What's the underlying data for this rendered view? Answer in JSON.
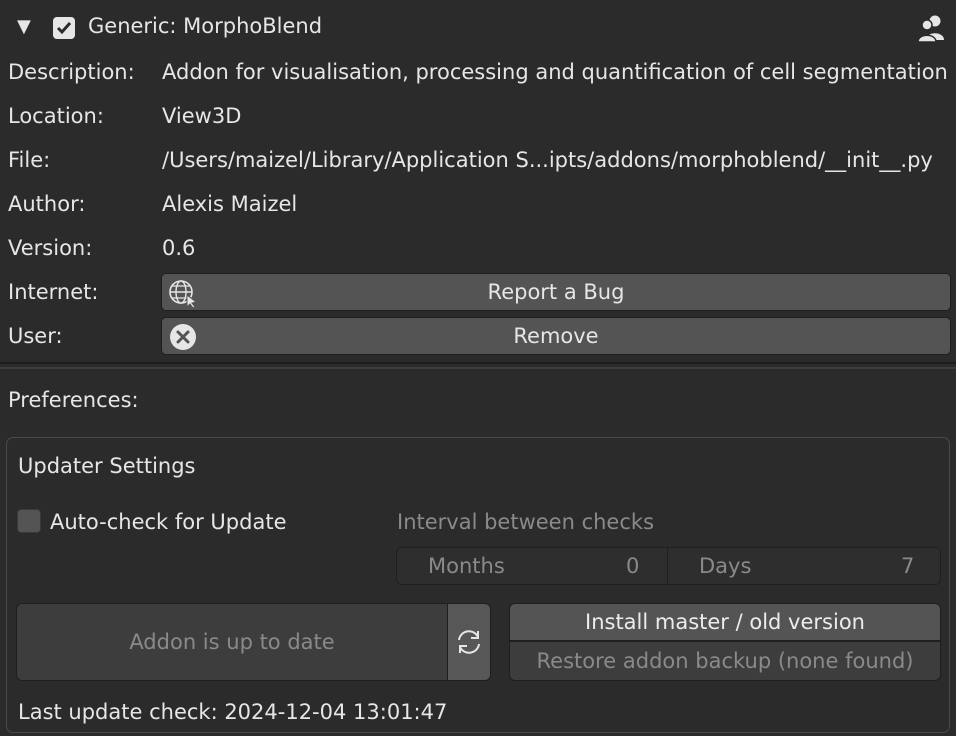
{
  "addon": {
    "title": "Generic: MorphoBlend",
    "enabled": true
  },
  "info": {
    "description_label": "Description:",
    "description_value": "Addon for visualisation, processing and quantification of cell segmentation",
    "location_label": "Location:",
    "location_value": "View3D",
    "file_label": "File:",
    "file_value": "/Users/maizel/Library/Application S...ipts/addons/morphoblend/__init__.py",
    "author_label": "Author:",
    "author_value": "Alexis Maizel",
    "version_label": "Version:",
    "version_value": "0.6",
    "internet_label": "Internet:",
    "report_bug_label": "Report a Bug",
    "user_label": "User:",
    "remove_label": "Remove"
  },
  "preferences": {
    "heading": "Preferences:",
    "updater": {
      "title": "Updater Settings",
      "autocheck_label": "Auto-check for Update",
      "autocheck_checked": false,
      "interval_label": "Interval between checks",
      "months_label": "Months",
      "months_value": "0",
      "days_label": "Days",
      "days_value": "7",
      "status_label": "Addon is up to date",
      "install_label": "Install master / old version",
      "restore_label": "Restore addon backup (none found)",
      "last_check": "Last update check: 2024-12-04 13:01:47"
    }
  },
  "icons": [
    "disclosure-triangle-icon",
    "checkbox-icon",
    "users-icon",
    "globe-icon",
    "remove-icon",
    "refresh-icon"
  ],
  "colors": {
    "background": "#2b2b2b",
    "button": "#545454",
    "text": "#e6e6e6",
    "dim_text": "#8a8a8a"
  }
}
